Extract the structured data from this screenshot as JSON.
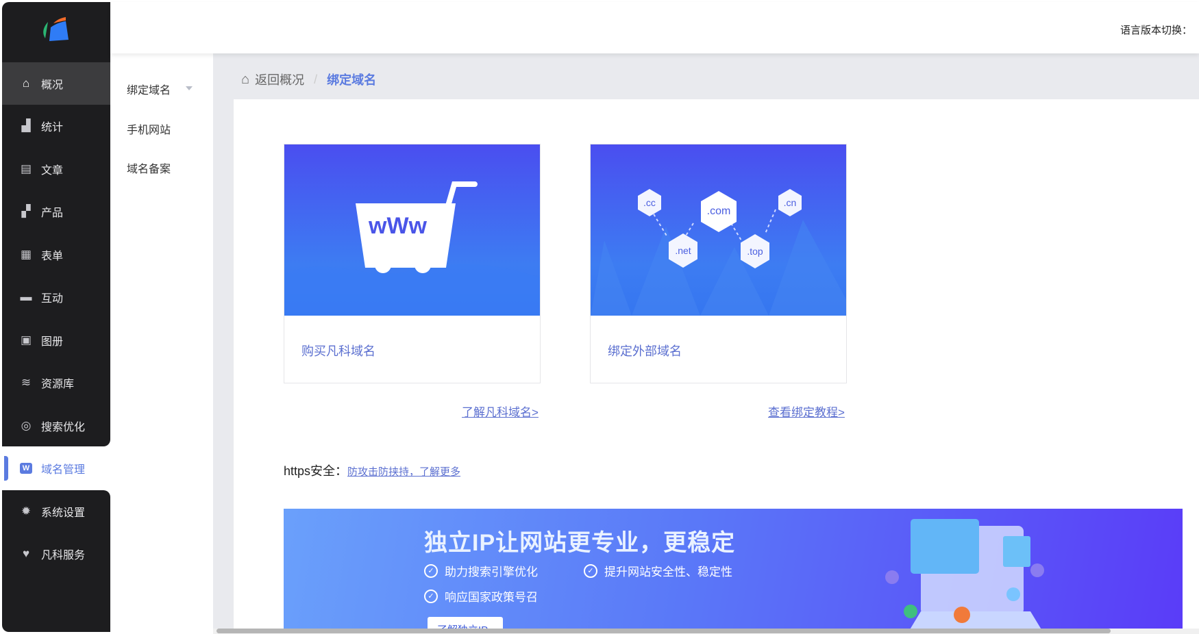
{
  "header": {
    "lang_label": "语言版本切换："
  },
  "sidebar": {
    "items": [
      {
        "label": "概况",
        "icon": "home-icon"
      },
      {
        "label": "统计",
        "icon": "chart-icon"
      },
      {
        "label": "文章",
        "icon": "article-icon"
      },
      {
        "label": "产品",
        "icon": "product-icon"
      },
      {
        "label": "表单",
        "icon": "form-icon"
      },
      {
        "label": "互动",
        "icon": "chat-icon"
      },
      {
        "label": "图册",
        "icon": "album-icon"
      },
      {
        "label": "资源库",
        "icon": "database-icon"
      },
      {
        "label": "搜索优化",
        "icon": "seo-icon"
      },
      {
        "label": "域名管理",
        "icon": "domain-icon",
        "badge": "W"
      },
      {
        "label": "系统设置",
        "icon": "gear-icon"
      },
      {
        "label": "凡科服务",
        "icon": "heart-icon"
      }
    ]
  },
  "submenu": {
    "items": [
      "绑定域名",
      "手机网站",
      "域名备案"
    ]
  },
  "breadcrumb": {
    "back": "返回概况",
    "sep": "/",
    "current": "绑定域名"
  },
  "cards": [
    {
      "label": "购买凡科域名",
      "image_text": "wWw",
      "link": "了解凡科域名>"
    },
    {
      "label": "绑定外部域名",
      "tlds": [
        ".cc",
        ".com",
        ".cn",
        ".net",
        ".top"
      ],
      "link": "查看绑定教程>"
    }
  ],
  "https": {
    "label": "https安全：",
    "link": "防攻击防挟持，了解更多"
  },
  "banner": {
    "title": "独立IP让网站更专业，更稳定",
    "features": [
      "助力搜索引擎优化",
      "提升网站安全性、稳定性",
      "响应国家政策号召"
    ],
    "button": "了解独立IP"
  }
}
